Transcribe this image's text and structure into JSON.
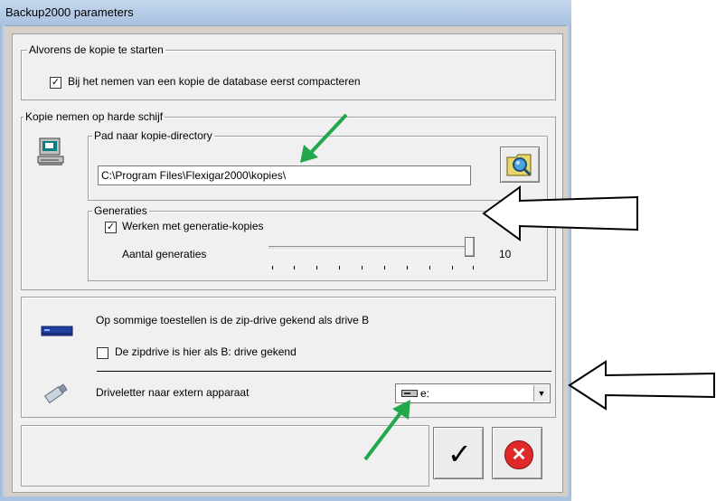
{
  "window": {
    "title": "Backup2000 parameters"
  },
  "group_before": {
    "legend": "Alvorens de kopie te starten",
    "compact_label": "Bij het nemen van een kopie de database eerst compacteren",
    "compact_checked": true
  },
  "group_disk": {
    "legend": "Kopie nemen op harde schijf",
    "path_legend": "Pad naar kopie-directory",
    "path_value": "C:\\Program Files\\Flexigar2000\\kopies\\",
    "generations_legend": "Generaties",
    "generations_label": "Werken met generatie-kopies",
    "generations_checked": true,
    "count_label": "Aantal generaties",
    "count_value": "10",
    "slider_fraction": 1.0
  },
  "external": {
    "zip_info": "Op sommige toestellen is de zip-drive gekend als drive B",
    "zip_label": "De zipdrive is hier als B: drive gekend",
    "zip_checked": false,
    "drive_label": "Driveletter naar extern apparaat",
    "drive_value": "e:"
  },
  "buttons": {
    "ok_glyph": "✓",
    "cancel_glyph": "✕"
  },
  "icons": [
    "computer-icon",
    "folder-search-icon",
    "zip-drive-icon",
    "usb-drive-icon",
    "drive-icon",
    "checkmark-icon",
    "cancel-icon"
  ],
  "annotation_colors": {
    "green_arrow": "#22a84a",
    "outline_arrow": "#000000"
  }
}
